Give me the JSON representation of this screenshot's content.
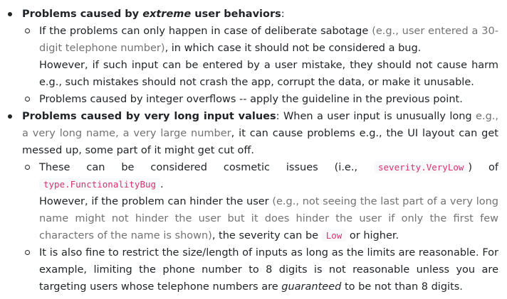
{
  "items": [
    {
      "title_a": "Problems caused by ",
      "title_em": "extreme",
      "title_b": " user behaviors",
      "title_suffix": ":",
      "subs": [
        {
          "p1_a": "If the problems can only happen in case of deliberate sabotage ",
          "p1_muted": "(e.g., user entered a 30-digit telephone number)",
          "p1_b": ", in which case it should not be considered a bug.",
          "p2": "However, if such input can be entered by a user mistake, they should not cause harm e.g., such mistakes should not crash the app, corrupt the data, or make it unusable."
        },
        {
          "text": "Problems caused by integer overflows -- apply the guideline in the previous point."
        }
      ]
    },
    {
      "title": "Problems caused by very long input values",
      "lead_a": ": When a user input is unusually long ",
      "lead_muted": "e.g., a very long name, a very large number",
      "lead_b": ", it can cause problems e.g., the UI layout can get messed up, some part of it might get cut off.",
      "subs": [
        {
          "p1_a": "These can be considered cosmetic issues (i.e., ",
          "code1": "severity.VeryLow",
          "p1_b": ") of ",
          "code2": "type.FunctionalityBug",
          "p1_c": ".",
          "p2_a": "However, if the problem can hinder the user ",
          "p2_muted": "(e.g., not seeing the last part of a very long name might not hinder the user but it does hinder the user if only the first few characters of the name is shown)",
          "p2_b": ", the severity can be ",
          "code3": "Low",
          "p2_c": " or higher."
        },
        {
          "p_a": "It is also fine to restrict the size/length of inputs as long as the limits are reasonable. For example, limiting the phone number to 8 digits is not reasonable unless you are targeting users whose telephone numbers are ",
          "p_em": "guaranteed",
          "p_b": " to be not than 8 digits."
        }
      ]
    }
  ]
}
